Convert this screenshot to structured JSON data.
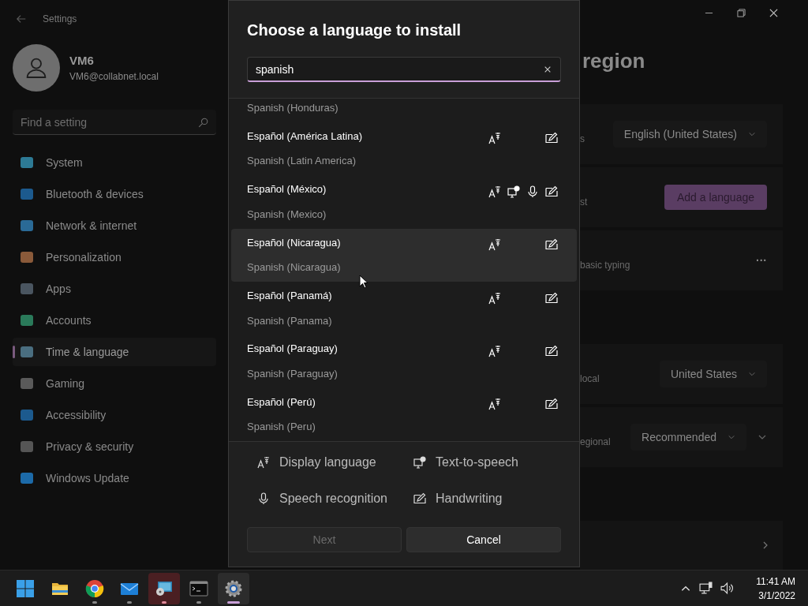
{
  "window": {
    "title": "Settings"
  },
  "user": {
    "name": "VM6",
    "email": "VM6@collabnet.local"
  },
  "search": {
    "placeholder": "Find a setting"
  },
  "sidebar": {
    "items": [
      {
        "label": "System",
        "color": "#2d7a95",
        "selected": false
      },
      {
        "label": "Bluetooth & devices",
        "color": "#1c5a8e",
        "selected": false
      },
      {
        "label": "Network & internet",
        "color": "#2a6a96",
        "selected": false
      },
      {
        "label": "Personalization",
        "color": "#8a5a3a",
        "selected": false
      },
      {
        "label": "Apps",
        "color": "#4a5560",
        "selected": false
      },
      {
        "label": "Accounts",
        "color": "#2a7a5a",
        "selected": false
      },
      {
        "label": "Time & language",
        "color": "#4a6e80",
        "selected": true
      },
      {
        "label": "Gaming",
        "color": "#5a5a5a",
        "selected": false
      },
      {
        "label": "Accessibility",
        "color": "#1c5a8e",
        "selected": false
      },
      {
        "label": "Privacy & security",
        "color": "#555555",
        "selected": false
      },
      {
        "label": "Windows Update",
        "color": "#1c6aa8",
        "selected": false
      }
    ]
  },
  "page": {
    "title": "region",
    "cards": [
      {
        "kind": "dropdown",
        "label": "s",
        "value": "English (United States)"
      },
      {
        "kind": "button",
        "label": "st",
        "value": "Add a language"
      },
      {
        "kind": "more",
        "label": "basic typing",
        "value": "···"
      },
      {
        "kind": "gap"
      },
      {
        "kind": "dropdown",
        "label": "local",
        "value": "United States"
      },
      {
        "kind": "dropdown-expand",
        "label": "egional",
        "value": "Recommended"
      },
      {
        "kind": "gap"
      },
      {
        "kind": "link"
      }
    ]
  },
  "dialog": {
    "title": "Choose a language to install",
    "search_value": "spanish",
    "languages": [
      {
        "english": "Spanish (Honduras)"
      },
      {
        "name": "Español (América Latina)",
        "english": "Spanish (Latin America)",
        "display": true,
        "tts": false,
        "speech": false,
        "handwriting": true,
        "highlighted": false
      },
      {
        "name": "Español (México)",
        "english": "Spanish (Mexico)",
        "display": true,
        "tts": true,
        "speech": true,
        "handwriting": true,
        "highlighted": false
      },
      {
        "name": "Español (Nicaragua)",
        "english": "Spanish (Nicaragua)",
        "display": true,
        "tts": false,
        "speech": false,
        "handwriting": true,
        "highlighted": true
      },
      {
        "name": "Español (Panamá)",
        "english": "Spanish (Panama)",
        "display": true,
        "tts": false,
        "speech": false,
        "handwriting": true,
        "highlighted": false
      },
      {
        "name": "Español (Paraguay)",
        "english": "Spanish (Paraguay)",
        "display": true,
        "tts": false,
        "speech": false,
        "handwriting": true,
        "highlighted": false
      },
      {
        "name": "Español (Perú)",
        "english": "Spanish (Peru)",
        "display": true,
        "tts": false,
        "speech": false,
        "handwriting": true,
        "highlighted": false
      }
    ],
    "legend": [
      {
        "kind": "display",
        "label": "Display language"
      },
      {
        "kind": "tts",
        "label": "Text-to-speech"
      },
      {
        "kind": "speech",
        "label": "Speech recognition"
      },
      {
        "kind": "handwriting",
        "label": "Handwriting"
      }
    ],
    "buttons": [
      {
        "label": "Next",
        "disabled": true
      },
      {
        "label": "Cancel",
        "disabled": false
      }
    ]
  },
  "taskbar": {
    "apps": [
      {
        "kind": "start",
        "running": false,
        "active": false,
        "flashing": false
      },
      {
        "kind": "folder",
        "running": false,
        "active": false,
        "flashing": false
      },
      {
        "kind": "browser",
        "running": true,
        "active": false,
        "flashing": false
      },
      {
        "kind": "mail",
        "running": true,
        "active": false,
        "flashing": false
      },
      {
        "kind": "remote",
        "running": true,
        "active": false,
        "flashing": true
      },
      {
        "kind": "terminal",
        "running": true,
        "active": false,
        "flashing": false
      },
      {
        "kind": "settings",
        "running": true,
        "active": true,
        "flashing": false
      }
    ],
    "time": "11:41 AM",
    "date": "3/1/2022"
  }
}
